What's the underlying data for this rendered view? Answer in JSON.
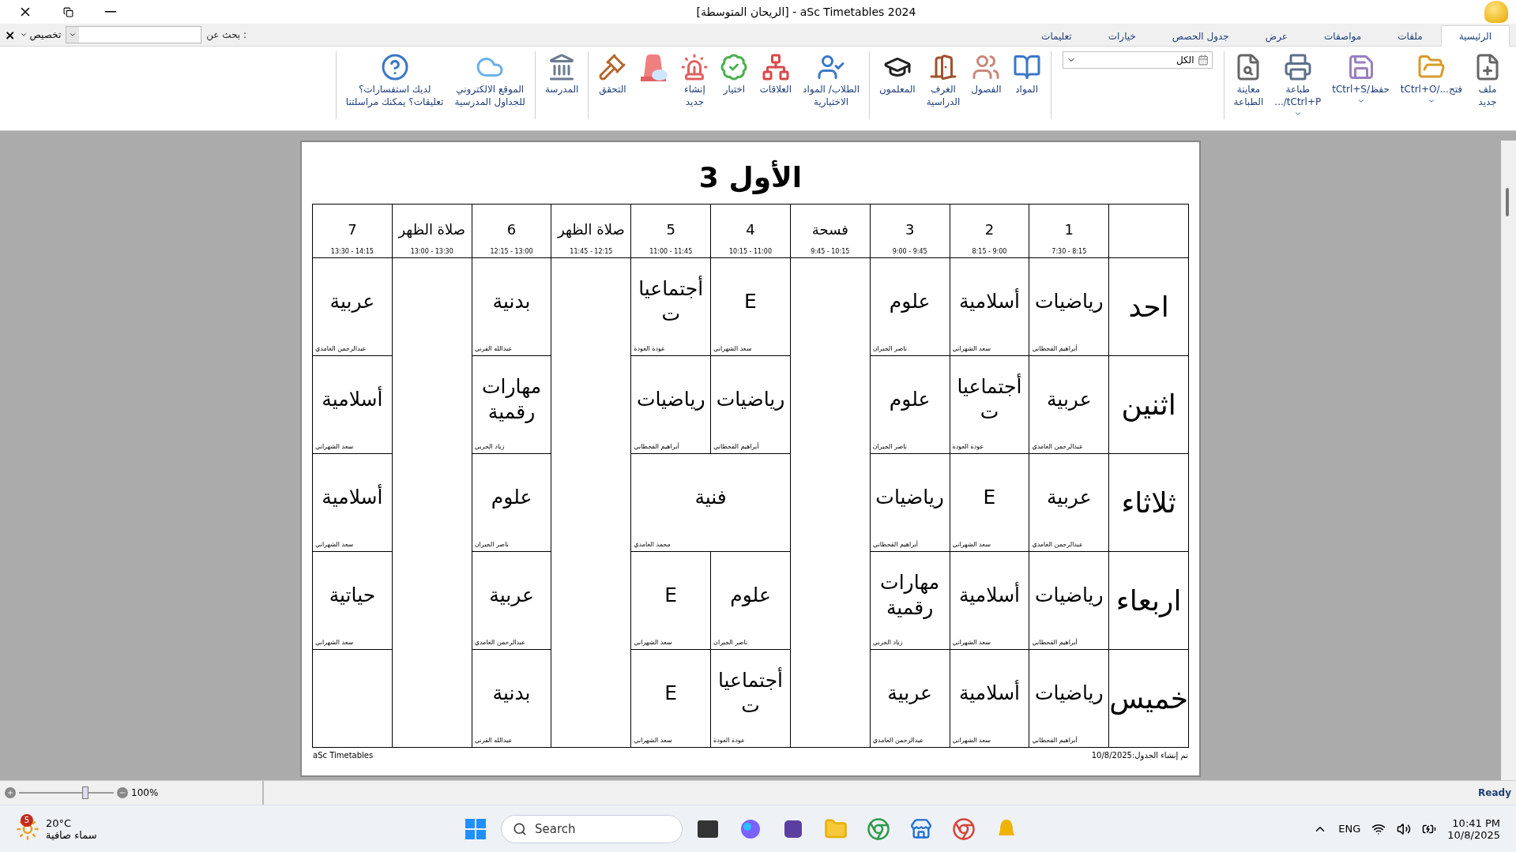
{
  "window": {
    "title": "aSc Timetables 2024 - [الريحان المتوسطة]"
  },
  "tabs": [
    {
      "label": "الرئيسية",
      "selected": true
    },
    {
      "label": "ملفات",
      "selected": false
    },
    {
      "label": "مواصفات",
      "selected": false
    },
    {
      "label": "عرض",
      "selected": false
    },
    {
      "label": "جدول الحصص",
      "selected": false
    },
    {
      "label": "خيارات",
      "selected": false
    },
    {
      "label": "تعليمات",
      "selected": false
    }
  ],
  "search": {
    "label": "بحث عن :",
    "customize": "تخصيص",
    "close": "×"
  },
  "ribbon": {
    "groups": [
      {
        "kind": "buttons",
        "items": [
          {
            "label": "ملف\nجديد",
            "menu": false
          },
          {
            "label": "فتح.../tCtrl+O",
            "menu": true
          },
          {
            "label": "حفظ/tCtrl+S",
            "menu": true
          },
          {
            "label": "طباعة\ntCtrl+P/...",
            "menu": true
          },
          {
            "label": "معاينة\nالطباعة",
            "menu": false
          }
        ]
      },
      {
        "kind": "filter",
        "value": "الكل"
      },
      {
        "kind": "buttons",
        "items": [
          {
            "label": "المواد",
            "menu": false
          },
          {
            "label": "الفصول",
            "menu": false
          },
          {
            "label": "الغرف\nالدراسية",
            "menu": false
          },
          {
            "label": "المعلمون",
            "menu": false
          }
        ]
      },
      {
        "kind": "buttons",
        "items": [
          {
            "label": "الطلاب/ المواد\nالاختيارية",
            "menu": false
          },
          {
            "label": "العلاقات",
            "menu": false
          },
          {
            "label": "اختيار",
            "menu": false
          },
          {
            "label": "إنشاء\nجديد",
            "menu": false
          },
          {
            "kind": "icon_only",
            "menu": false
          },
          {
            "label": "التحقق",
            "menu": false
          }
        ]
      },
      {
        "kind": "buttons",
        "items": [
          {
            "label": "المدرسة",
            "menu": false
          }
        ]
      },
      {
        "kind": "buttons",
        "items": [
          {
            "label": "الموقع الالكتروني\nللجداول المدرسية",
            "menu": false
          },
          {
            "label": "لديك استفسارات؟\nتعليقات؟ يمكنك مراسلتنا",
            "menu": false
          }
        ]
      }
    ]
  },
  "timetable": {
    "title": "الأول 3",
    "columns": [
      {
        "kind": "period",
        "label": "1",
        "time": "7:30 - 8:15"
      },
      {
        "kind": "period",
        "label": "2",
        "time": "8:15 - 9:00"
      },
      {
        "kind": "period",
        "label": "3",
        "time": "9:00 - 9:45"
      },
      {
        "kind": "break",
        "label": "فسحة",
        "time": "9:45 - 10:15"
      },
      {
        "kind": "period",
        "label": "4",
        "time": "10:15 - 11:00"
      },
      {
        "kind": "period",
        "label": "5",
        "time": "11:00 - 11:45"
      },
      {
        "kind": "break",
        "label": "صلاة الظهر",
        "time": "11:45 - 12:15"
      },
      {
        "kind": "period",
        "label": "6",
        "time": "12:15 - 13:00"
      },
      {
        "kind": "break",
        "label": "صلاة الظهر",
        "time": "13:00 - 13:30"
      },
      {
        "kind": "period",
        "label": "7",
        "time": "13:30 - 14:15"
      }
    ],
    "days": [
      {
        "day": "احد",
        "lessons": [
          {
            "kind": "single",
            "subject": "رياضيات",
            "teacher": "أبراهيم القحطاني"
          },
          {
            "kind": "single",
            "subject": "أسلامية",
            "teacher": "سعد الشهراني"
          },
          {
            "kind": "single",
            "subject": "علوم",
            "teacher": "ناصر الجبران"
          },
          {
            "kind": "single",
            "subject": "E",
            "teacher": "سعد الشهراني"
          },
          {
            "kind": "single",
            "subject": "أجتماعيات",
            "teacher": "عودة العودة"
          },
          {
            "kind": "single",
            "subject": "بدنية",
            "teacher": "عبدالله القرني"
          },
          {
            "kind": "single",
            "subject": "عربية",
            "teacher": "عبدالرحمن الغامدي"
          }
        ]
      },
      {
        "day": "اثنين",
        "lessons": [
          {
            "kind": "single",
            "subject": "عربية",
            "teacher": "عبدالرحمن الغامدي"
          },
          {
            "kind": "single",
            "subject": "أجتماعيات",
            "teacher": "عودة العودة"
          },
          {
            "kind": "single",
            "subject": "علوم",
            "teacher": "ناصر الجبران"
          },
          {
            "kind": "single",
            "subject": "رياضيات",
            "teacher": "أبراهيم القحطاني"
          },
          {
            "kind": "single",
            "subject": "رياضيات",
            "teacher": "أبراهيم القحطاني"
          },
          {
            "kind": "single",
            "subject": "مهارات رقمية",
            "teacher": "زياد الحربي"
          },
          {
            "kind": "single",
            "subject": "أسلامية",
            "teacher": "سعد الشهراني"
          }
        ]
      },
      {
        "day": "ثلاثاء",
        "lessons": [
          {
            "kind": "single",
            "subject": "عربية",
            "teacher": "عبدالرحمن الغامدي"
          },
          {
            "kind": "single",
            "subject": "E",
            "teacher": "سعد الشهراني"
          },
          {
            "kind": "single",
            "subject": "رياضيات",
            "teacher": "أبراهيم القحطاني"
          },
          {
            "kind": "double",
            "subject": "فنية",
            "teacher": "محمد الغامدي"
          },
          {
            "kind": "single",
            "subject": "علوم",
            "teacher": "ناصر الجبران"
          },
          {
            "kind": "single",
            "subject": "أسلامية",
            "teacher": "سعد الشهراني"
          }
        ]
      },
      {
        "day": "اربعاء",
        "lessons": [
          {
            "kind": "single",
            "subject": "رياضيات",
            "teacher": "أبراهيم القحطاني"
          },
          {
            "kind": "single",
            "subject": "أسلامية",
            "teacher": "سعد الشهراني"
          },
          {
            "kind": "single",
            "subject": "مهارات رقمية",
            "teacher": "زياد الحربي"
          },
          {
            "kind": "single",
            "subject": "علوم",
            "teacher": "ناصر الجبران"
          },
          {
            "kind": "single",
            "subject": "E",
            "teacher": "سعد الشهراني"
          },
          {
            "kind": "single",
            "subject": "عربية",
            "teacher": "عبدالرحمن الغامدي"
          },
          {
            "kind": "single",
            "subject": "حياتية",
            "teacher": "سعد الشهراني"
          }
        ]
      },
      {
        "day": "خميس",
        "lessons": [
          {
            "kind": "single",
            "subject": "رياضيات",
            "teacher": "أبراهيم القحطاني"
          },
          {
            "kind": "single",
            "subject": "أسلامية",
            "teacher": "سعد الشهراني"
          },
          {
            "kind": "single",
            "subject": "عربية",
            "teacher": "عبدالرحمن الغامدي"
          },
          {
            "kind": "single",
            "subject": "أجتماعيات",
            "teacher": "عودة العودة"
          },
          {
            "kind": "single",
            "subject": "E",
            "teacher": "سعد الشهراني"
          },
          {
            "kind": "single",
            "subject": "بدنية",
            "teacher": "عبدالله القرني"
          },
          {
            "kind": "empty"
          }
        ]
      }
    ],
    "footer_left": "aSc Timetables",
    "footer_right": "تم إنشاء الجدول:10/8/2025"
  },
  "status_bar": {
    "zoom": {
      "level": 0.7,
      "reading": "100%"
    },
    "status": "Ready"
  },
  "taskbar": {
    "weather": {
      "badge": "5",
      "temperature": "20°C",
      "condition": "سماء صافية"
    },
    "search": "Search",
    "language": "ENG",
    "time": "10:41 PM",
    "date": "10/8/2025"
  }
}
